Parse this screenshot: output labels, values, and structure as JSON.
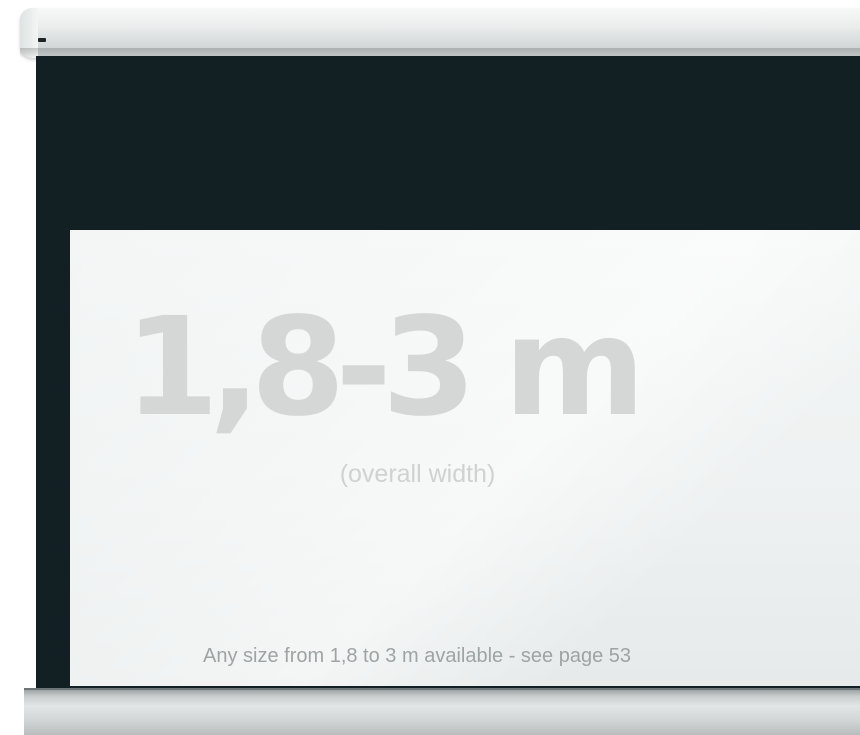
{
  "screen": {
    "size_headline": "1,8-3 m",
    "size_subtitle": "(overall width)",
    "availability": "Any size from 1,8 to 3 m available - see page 53"
  },
  "colors": {
    "frame": "#132023",
    "surface": "#eef1f1",
    "casing": "#e8ebeb",
    "bottom_bar": "#d3d7d8",
    "headline_text": "#d5d7d7",
    "note_text": "#9ea3a4"
  }
}
